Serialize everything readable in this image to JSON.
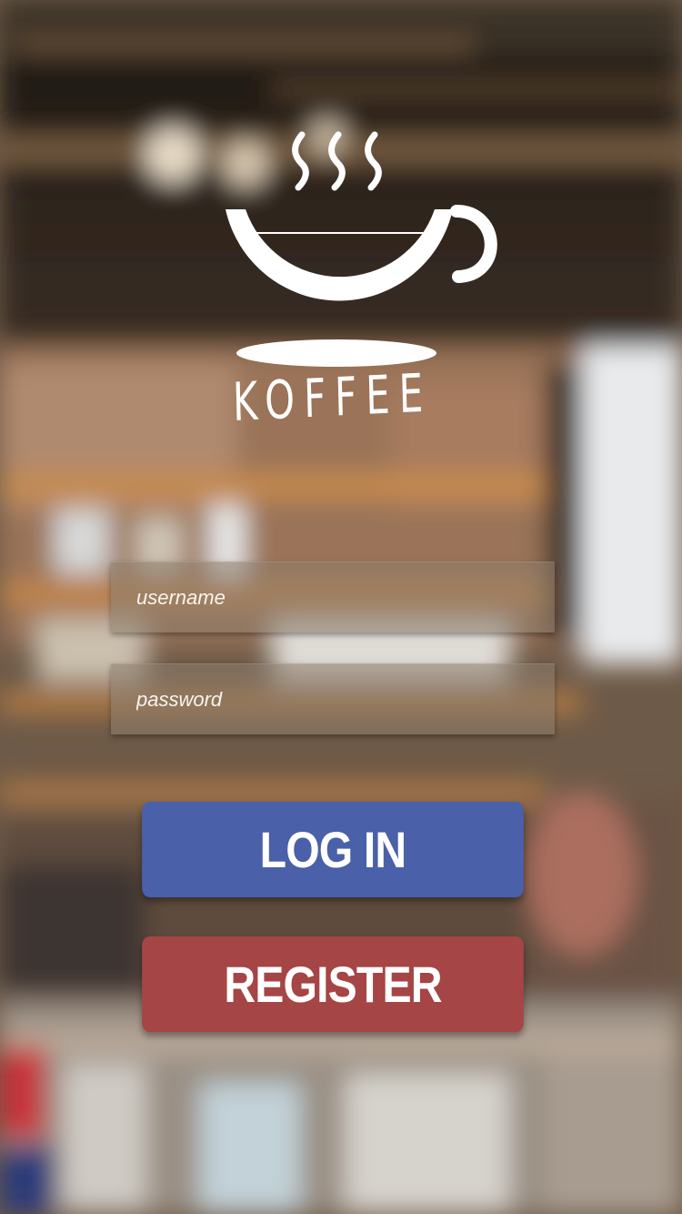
{
  "app": {
    "brand_name": "KOFFEE",
    "logo_icon": "coffee-cup-icon"
  },
  "form": {
    "username_placeholder": "username",
    "password_placeholder": "password",
    "username_value": "",
    "password_value": ""
  },
  "buttons": {
    "login_label": "LOG IN",
    "register_label": "REGISTER"
  },
  "colors": {
    "login_button": "#4a60a8",
    "register_button": "#a64545",
    "logo": "#ffffff"
  }
}
